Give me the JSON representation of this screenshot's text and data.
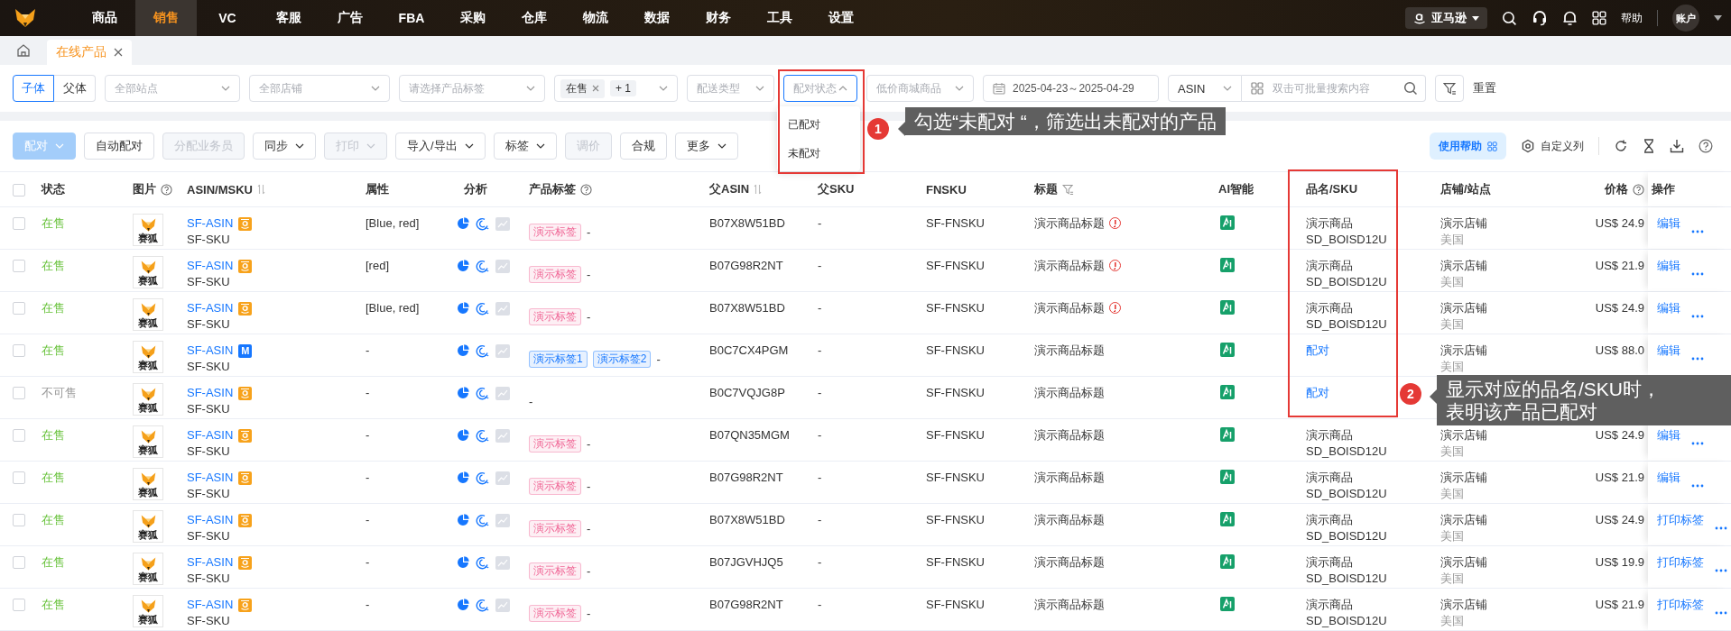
{
  "nav": {
    "items": [
      {
        "label": "商品",
        "selected": false
      },
      {
        "label": "销售",
        "selected": true
      },
      {
        "label": "VC",
        "selected": false
      },
      {
        "label": "客服",
        "selected": false
      },
      {
        "label": "广告",
        "selected": false
      },
      {
        "label": "FBA",
        "selected": false
      },
      {
        "label": "采购",
        "selected": false
      },
      {
        "label": "仓库",
        "selected": false
      },
      {
        "label": "物流",
        "selected": false
      },
      {
        "label": "数据",
        "selected": false
      },
      {
        "label": "财务",
        "selected": false
      },
      {
        "label": "工具",
        "selected": false
      },
      {
        "label": "设置",
        "selected": false
      }
    ],
    "platform": "亚马逊",
    "help": "帮助",
    "account": "账户"
  },
  "tabs": [
    {
      "label": "在线产品",
      "selected": true
    }
  ],
  "filters": {
    "view_toggle": [
      {
        "label": "子体",
        "selected": true
      },
      {
        "label": "父体",
        "selected": false
      }
    ],
    "site": {
      "placeholder": "全部站点"
    },
    "store": {
      "placeholder": "全部店铺"
    },
    "tag": {
      "placeholder": "请选择产品标签"
    },
    "status": {
      "chips": [
        {
          "label": "在售",
          "removable": true
        },
        {
          "label": "+ 1",
          "removable": false
        }
      ]
    },
    "shipping": {
      "placeholder": "配送类型"
    },
    "pairing": {
      "placeholder": "配对状态",
      "expanded": true,
      "options": [
        "已配对",
        "未配对"
      ]
    },
    "low_price": {
      "placeholder": "低价商城商品"
    },
    "date_range": {
      "value": "2025-04-23～2025-04-29"
    },
    "search_field": {
      "value": "ASIN"
    },
    "search": {
      "placeholder": "双击可批量搜索内容"
    },
    "reset": "重置"
  },
  "actions": [
    {
      "label": "配对",
      "kind": "primary",
      "disabled": true,
      "dropdown": true
    },
    {
      "label": "自动配对",
      "kind": "default",
      "disabled": false,
      "dropdown": false
    },
    {
      "label": "分配业务员",
      "kind": "default",
      "disabled": true,
      "dropdown": false
    },
    {
      "label": "同步",
      "kind": "default",
      "disabled": false,
      "dropdown": true
    },
    {
      "label": "打印",
      "kind": "default",
      "disabled": true,
      "dropdown": true
    },
    {
      "label": "导入/导出",
      "kind": "default",
      "disabled": false,
      "dropdown": true
    },
    {
      "label": "标签",
      "kind": "default",
      "disabled": false,
      "dropdown": true
    },
    {
      "label": "调价",
      "kind": "default",
      "disabled": true,
      "dropdown": false
    },
    {
      "label": "合规",
      "kind": "default",
      "disabled": false,
      "dropdown": false
    },
    {
      "label": "更多",
      "kind": "default",
      "disabled": false,
      "dropdown": true
    }
  ],
  "toolbar_right": {
    "help": "使用帮助",
    "custom_columns": "自定义列"
  },
  "table": {
    "columns": [
      {
        "kind": "checkbox",
        "checked": false
      },
      {
        "kind": "text",
        "label": "状态"
      },
      {
        "kind": "help",
        "label": "图片"
      },
      {
        "kind": "sortable",
        "label": "ASIN/MSKU"
      },
      {
        "kind": "text",
        "label": "属性"
      },
      {
        "kind": "text",
        "label": "分析"
      },
      {
        "kind": "help",
        "label": "产品标签"
      },
      {
        "kind": "sortable",
        "label": "父ASIN"
      },
      {
        "kind": "text",
        "label": "父SKU"
      },
      {
        "kind": "text",
        "label": "FNSKU"
      },
      {
        "kind": "filterable",
        "label": "标题"
      },
      {
        "kind": "text",
        "label": "AI智能"
      },
      {
        "kind": "text",
        "label": "品名/SKU"
      },
      {
        "kind": "text",
        "label": "店铺/站点"
      },
      {
        "kind": "help",
        "label": "价格"
      },
      {
        "kind": "text",
        "label": "操作"
      }
    ],
    "rows": [
      {
        "checked": false,
        "status": "在售",
        "available": true,
        "image_caption": "赛狐",
        "asin": "SF-ASIN",
        "channel": {
          "kind": "shop"
        },
        "msku": "SF-SKU",
        "attributes": "[Blue, red]",
        "tags": [
          {
            "label": "演示标签",
            "color": "#f06595"
          }
        ],
        "tag_suffix": "-",
        "parent_asin": "B07X8W51BD",
        "parent_sku": "-",
        "fnsku": "SF-FNSKU",
        "title": "演示商品标题",
        "warning": true,
        "pairing": {
          "kind": "paired",
          "name": "演示商品",
          "sku": "SD_BOISD12U"
        },
        "store": "演示店铺",
        "site": "美国",
        "price": "US$ 24.9",
        "action": "编辑",
        "more": true
      },
      {
        "checked": false,
        "status": "在售",
        "available": true,
        "image_caption": "赛狐",
        "asin": "SF-ASIN",
        "channel": {
          "kind": "shop"
        },
        "msku": "SF-SKU",
        "attributes": "[red]",
        "tags": [
          {
            "label": "演示标签",
            "color": "#f06595"
          }
        ],
        "tag_suffix": "-",
        "parent_asin": "B07G98R2NT",
        "parent_sku": "-",
        "fnsku": "SF-FNSKU",
        "title": "演示商品标题",
        "warning": true,
        "pairing": {
          "kind": "paired",
          "name": "演示商品",
          "sku": "SD_BOISD12U"
        },
        "store": "演示店铺",
        "site": "美国",
        "price": "US$ 21.9",
        "action": "编辑",
        "more": true
      },
      {
        "checked": false,
        "status": "在售",
        "available": true,
        "image_caption": "赛狐",
        "asin": "SF-ASIN",
        "channel": {
          "kind": "shop"
        },
        "msku": "SF-SKU",
        "attributes": "[Blue, red]",
        "tags": [
          {
            "label": "演示标签",
            "color": "#f06595"
          }
        ],
        "tag_suffix": "-",
        "parent_asin": "B07X8W51BD",
        "parent_sku": "-",
        "fnsku": "SF-FNSKU",
        "title": "演示商品标题",
        "warning": true,
        "pairing": {
          "kind": "paired",
          "name": "演示商品",
          "sku": "SD_BOISD12U"
        },
        "store": "演示店铺",
        "site": "美国",
        "price": "US$ 24.9",
        "action": "编辑",
        "more": true
      },
      {
        "checked": false,
        "status": "在售",
        "available": true,
        "image_caption": "赛狐",
        "asin": "SF-ASIN",
        "channel": {
          "kind": "letter",
          "text": "M"
        },
        "msku": "SF-SKU",
        "attributes": "-",
        "tags": [
          {
            "label": "演示标签1",
            "color": "#1677ff"
          },
          {
            "label": "演示标签2",
            "color": "#1677ff"
          }
        ],
        "tag_suffix": "-",
        "parent_asin": "B0C7CX4PGM",
        "parent_sku": "-",
        "fnsku": "SF-FNSKU",
        "title": "演示商品标题",
        "warning": false,
        "pairing": {
          "kind": "link",
          "label": "配对"
        },
        "store": "演示店铺",
        "site": "美国",
        "price": "US$ 88.0",
        "action": "编辑",
        "more": true
      },
      {
        "checked": false,
        "status": "不可售",
        "available": false,
        "image_caption": "赛狐",
        "asin": "SF-ASIN",
        "channel": {
          "kind": "shop"
        },
        "msku": "SF-SKU",
        "attributes": "-",
        "tag_suffix": "-",
        "parent_asin": "B0C7VQJG8P",
        "parent_sku": "-",
        "fnsku": "SF-FNSKU",
        "title": "演示商品标题",
        "warning": false,
        "pairing": {
          "kind": "link",
          "label": "配对"
        }
      },
      {
        "checked": false,
        "status": "在售",
        "available": true,
        "image_caption": "赛狐",
        "asin": "SF-ASIN",
        "channel": {
          "kind": "shop"
        },
        "msku": "SF-SKU",
        "attributes": "-",
        "tags": [
          {
            "label": "演示标签",
            "color": "#f06595"
          }
        ],
        "tag_suffix": "-",
        "parent_asin": "B07QN35MGM",
        "parent_sku": "-",
        "fnsku": "SF-FNSKU",
        "title": "演示商品标题",
        "warning": false,
        "pairing": {
          "kind": "paired",
          "name": "演示商品",
          "sku": "SD_BOISD12U"
        },
        "store": "演示店铺",
        "site": "美国",
        "price": "US$ 24.9",
        "action": "编辑",
        "more": true
      },
      {
        "checked": false,
        "status": "在售",
        "available": true,
        "image_caption": "赛狐",
        "asin": "SF-ASIN",
        "channel": {
          "kind": "shop"
        },
        "msku": "SF-SKU",
        "attributes": "-",
        "tags": [
          {
            "label": "演示标签",
            "color": "#f06595"
          }
        ],
        "tag_suffix": "-",
        "parent_asin": "B07G98R2NT",
        "parent_sku": "-",
        "fnsku": "SF-FNSKU",
        "title": "演示商品标题",
        "warning": false,
        "pairing": {
          "kind": "paired",
          "name": "演示商品",
          "sku": "SD_BOISD12U"
        },
        "store": "演示店铺",
        "site": "美国",
        "price": "US$ 21.9",
        "action": "编辑",
        "more": true
      },
      {
        "checked": false,
        "status": "在售",
        "available": true,
        "image_caption": "赛狐",
        "asin": "SF-ASIN",
        "channel": {
          "kind": "shop"
        },
        "msku": "SF-SKU",
        "attributes": "-",
        "tags": [
          {
            "label": "演示标签",
            "color": "#f06595"
          }
        ],
        "tag_suffix": "-",
        "parent_asin": "B07X8W51BD",
        "parent_sku": "-",
        "fnsku": "SF-FNSKU",
        "title": "演示商品标题",
        "warning": false,
        "pairing": {
          "kind": "paired",
          "name": "演示商品",
          "sku": "SD_BOISD12U"
        },
        "store": "演示店铺",
        "site": "美国",
        "price": "US$ 24.9",
        "action": "打印标签",
        "more": true
      },
      {
        "checked": false,
        "status": "在售",
        "available": true,
        "image_caption": "赛狐",
        "asin": "SF-ASIN",
        "channel": {
          "kind": "shop"
        },
        "msku": "SF-SKU",
        "attributes": "-",
        "tags": [
          {
            "label": "演示标签",
            "color": "#f06595"
          }
        ],
        "tag_suffix": "-",
        "parent_asin": "B07JGVHJQ5",
        "parent_sku": "-",
        "fnsku": "SF-FNSKU",
        "title": "演示商品标题",
        "warning": false,
        "pairing": {
          "kind": "paired",
          "name": "演示商品",
          "sku": "SD_BOISD12U"
        },
        "store": "演示店铺",
        "site": "美国",
        "price": "US$ 19.9",
        "action": "打印标签",
        "more": true
      },
      {
        "checked": false,
        "status": "在售",
        "available": true,
        "image_caption": "赛狐",
        "asin": "SF-ASIN",
        "channel": {
          "kind": "shop"
        },
        "msku": "SF-SKU",
        "attributes": "-",
        "tags": [
          {
            "label": "演示标签",
            "color": "#f06595"
          }
        ],
        "tag_suffix": "-",
        "parent_asin": "B07G98R2NT",
        "parent_sku": "-",
        "fnsku": "SF-FNSKU",
        "title": "演示商品标题",
        "warning": false,
        "pairing": {
          "kind": "paired",
          "name": "演示商品",
          "sku": "SD_BOISD12U"
        },
        "store": "演示店铺",
        "site": "美国",
        "price": "US$ 21.9",
        "action": "打印标签",
        "more": true
      }
    ]
  },
  "callouts": [
    {
      "number": "1",
      "lines": [
        "勾选“未配对 “，筛选出未配对的产品"
      ]
    },
    {
      "number": "2",
      "lines": [
        "显示对应的品名/SKU时，",
        "表明该产品已配对"
      ]
    }
  ]
}
